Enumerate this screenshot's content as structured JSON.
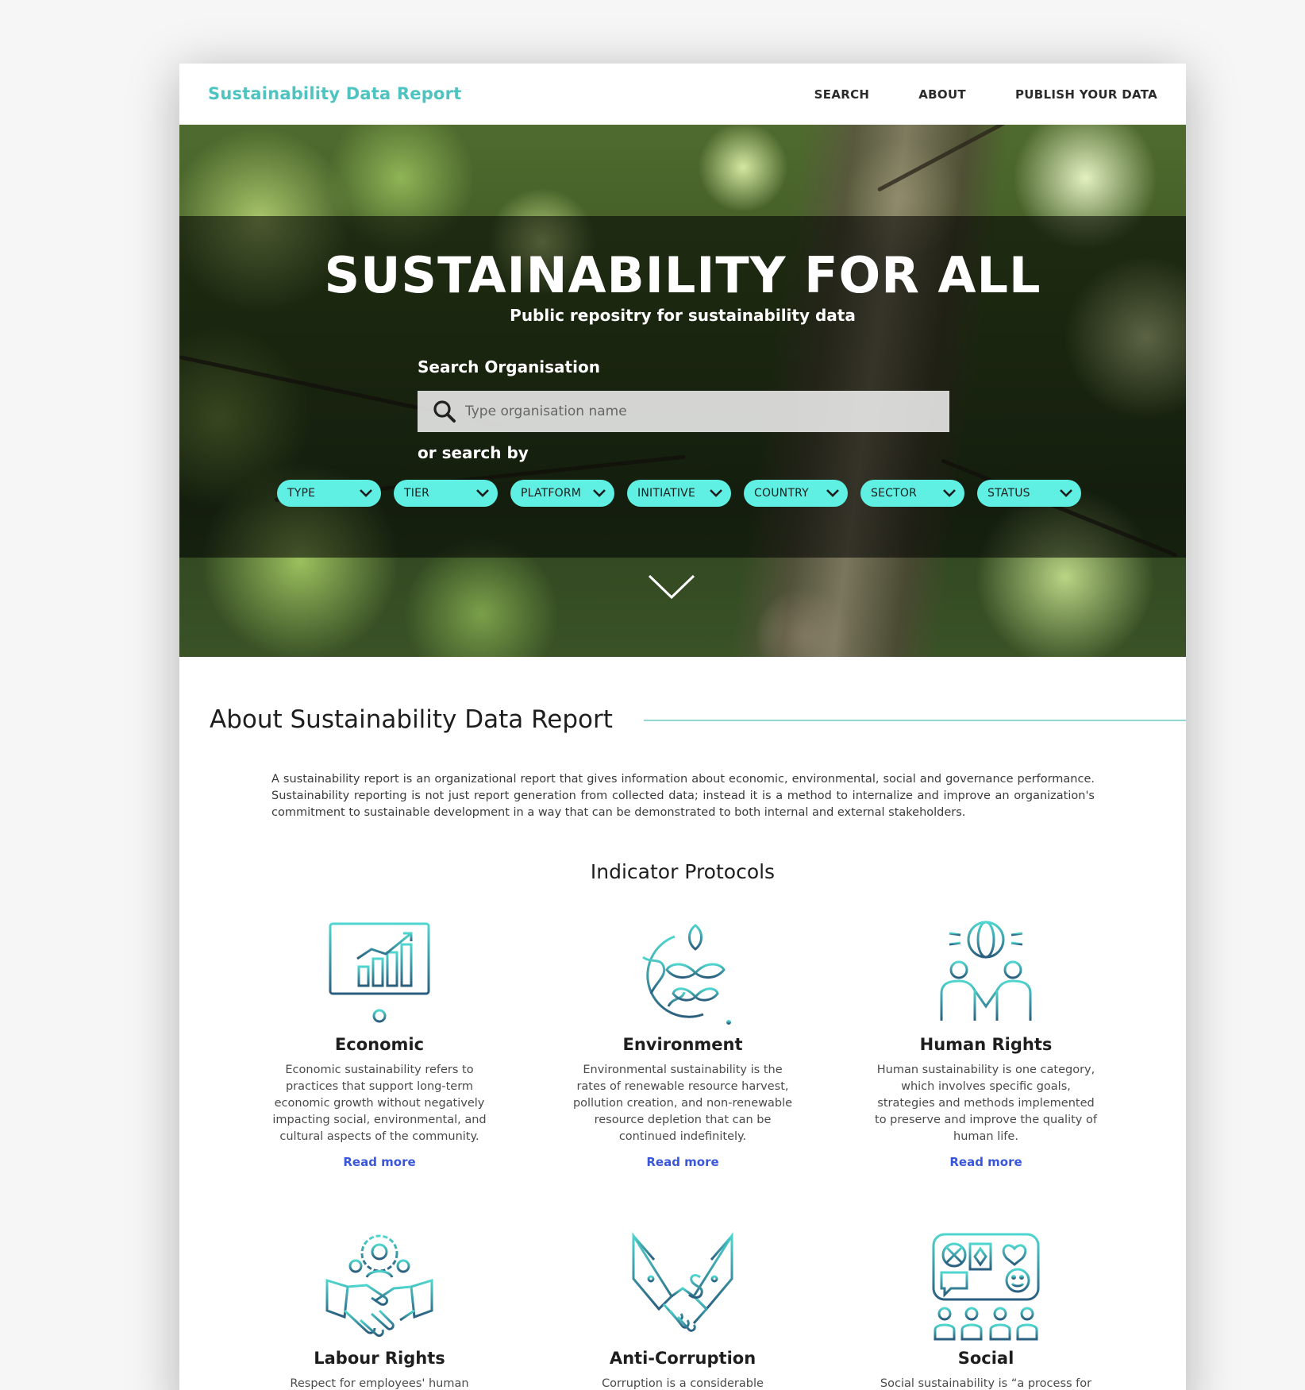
{
  "nav": {
    "brand": "Sustainability Data Report",
    "links": [
      "SEARCH",
      "ABOUT",
      "PUBLISH YOUR DATA"
    ]
  },
  "hero": {
    "title": "SUSTAINABILITY FOR ALL",
    "subtitle": "Public repositry for sustainability data",
    "search_label": "Search Organisation",
    "search_placeholder": "Type organisation name",
    "or_label": "or search by",
    "filters": [
      "TYPE",
      "TIER",
      "PLATFORM",
      "INITIATIVE",
      "COUNTRY",
      "SECTOR",
      "STATUS"
    ]
  },
  "about": {
    "heading": "About Sustainability Data Report",
    "text": "A sustainability report is an organizational report that gives information about economic, environmental, social and governance performance. Sustainability reporting is not just report generation from collected data; instead it is a method to internalize and improve an organization's commitment to sustainable development in a way that can be demonstrated to both internal and external stakeholders."
  },
  "protocols": {
    "heading": "Indicator Protocols",
    "cards": [
      {
        "title": "Economic",
        "icon": "presentation-chart-icon",
        "desc": "Economic sustainability refers to practices that support long-term economic growth without negatively impacting social, environmental, and cultural aspects of the community.",
        "link": "Read more"
      },
      {
        "title": "Environment",
        "icon": "earth-plant-icon",
        "desc": "Environmental sustainability is the rates of renewable resource harvest, pollution creation, and non-renewable resource depletion that can be continued indefinitely.",
        "link": "Read more"
      },
      {
        "title": "Human Rights",
        "icon": "globe-people-icon",
        "desc": "Human sustainability is one category, which involves specific goals, strategies and methods implemented to preserve and improve the quality of human life.",
        "link": "Read more"
      },
      {
        "title": "Labour Rights",
        "icon": "handshake-team-icon",
        "desc": "Respect for employees' human",
        "link": ""
      },
      {
        "title": "Anti-Corruption",
        "icon": "money-handshake-icon",
        "desc": "Corruption is a considerable",
        "link": ""
      },
      {
        "title": "Social",
        "icon": "community-board-icon",
        "desc": "Social sustainability is “a process for",
        "link": ""
      }
    ]
  },
  "colors": {
    "brand": "#4ec3bf",
    "pill": "#5ff0e3",
    "link": "#3b57d9",
    "icon_gradient": [
      "#4fd6cf",
      "#2b5e7e"
    ]
  }
}
